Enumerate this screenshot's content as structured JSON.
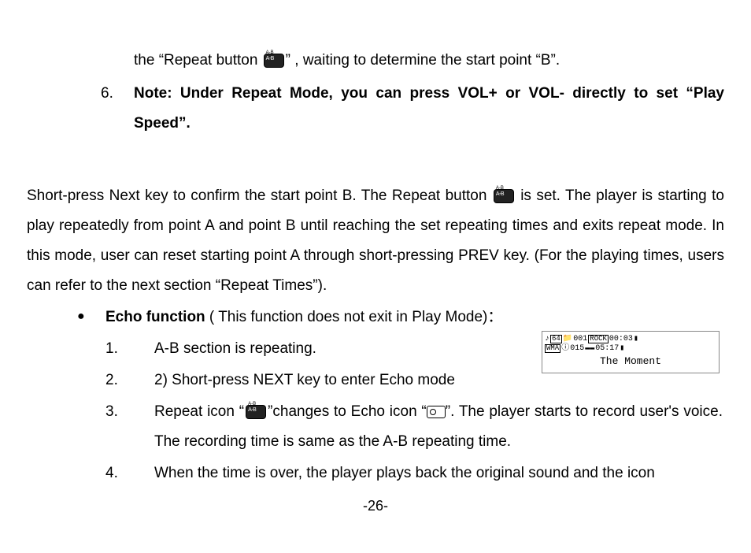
{
  "continuation": {
    "pre": "the “Repeat button ",
    "post": "” , waiting to determine the start point “B”."
  },
  "item6": {
    "num": "6.",
    "text": "Note: Under Repeat Mode, you can press VOL+ or VOL- directly to set “Play Speed”."
  },
  "para": {
    "pre": "Short-press Next key to confirm the start point B. The Repeat button ",
    "post": " is set. The player is starting to play repeatedly from point A and point B until reaching the set repeating times and exits repeat mode. In this mode, user can reset starting point A through short-pressing PREV key. (For the playing times, users can refer to the next section “Repeat Times”)."
  },
  "bullet": {
    "mark": "●",
    "bold": "Echo function",
    "rest": " ( This function does not exit in Play Mode)："
  },
  "sub": {
    "n1": "1.",
    "t1": "A-B section is repeating.",
    "n2": "2.",
    "t2": "2)    Short-press NEXT key to enter Echo mode",
    "n3": "3.",
    "t3_a": "Repeat icon “",
    "t3_b": "”changes to Echo icon “",
    "t3_c": "”. The player starts to record user's voice. The recording time is same as the A-B repeating time.",
    "n4": "4.",
    "t4": "When the time is over, the player plays back the original sound and the icon"
  },
  "mp3": {
    "bitrate": "64",
    "track": "001",
    "eq": "ROCK",
    "time1": "00:03",
    "fmt": "WMA",
    "total": "015",
    "time2": "05:17",
    "title": "The Moment"
  },
  "page_num": "-26-"
}
